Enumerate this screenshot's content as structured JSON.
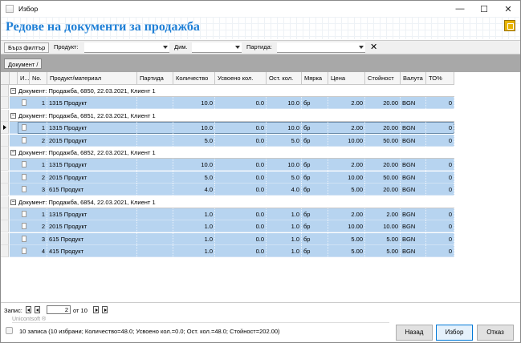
{
  "window": {
    "title": "Избор"
  },
  "header": {
    "title": "Редове на документи за продажба"
  },
  "filter": {
    "quick_filter_label": "Бърз филтър",
    "product_label": "Продукт:",
    "dim_label": "Дим.",
    "batch_label": "Партида:"
  },
  "grouping": {
    "chip_label": "Документ",
    "chip_sort": "/"
  },
  "columns": [
    "И...",
    "No.",
    "Продукт/материал",
    "Партида",
    "Количество",
    "Усвоено кол.",
    "Ост. кол.",
    "Мярка",
    "Цена",
    "Стойност",
    "Валута",
    "ТО%"
  ],
  "groups": [
    {
      "label": "Документ: Продажба, 6850, 22.03.2021, Клиент 1",
      "rows": [
        {
          "no": "1",
          "product": "1315 Продукт",
          "batch": "",
          "qty": "10.0",
          "used": "0.0",
          "rest": "10.0",
          "unit": "бр",
          "price": "2.00",
          "value": "20.00",
          "currency": "BGN",
          "to": "0"
        }
      ]
    },
    {
      "label": "Документ: Продажба, 6851, 22.03.2021, Клиент 1",
      "rows": [
        {
          "no": "1",
          "product": "1315 Продукт",
          "batch": "",
          "qty": "10.0",
          "used": "0.0",
          "rest": "10.0",
          "unit": "бр",
          "price": "2.00",
          "value": "20.00",
          "currency": "BGN",
          "to": "0"
        },
        {
          "no": "2",
          "product": "2015 Продукт",
          "batch": "",
          "qty": "5.0",
          "used": "0.0",
          "rest": "5.0",
          "unit": "бр",
          "price": "10.00",
          "value": "50.00",
          "currency": "BGN",
          "to": "0"
        }
      ]
    },
    {
      "label": "Документ: Продажба, 6852, 22.03.2021, Клиент 1",
      "rows": [
        {
          "no": "1",
          "product": "1315 Продукт",
          "batch": "",
          "qty": "10.0",
          "used": "0.0",
          "rest": "10.0",
          "unit": "бр",
          "price": "2.00",
          "value": "20.00",
          "currency": "BGN",
          "to": "0"
        },
        {
          "no": "2",
          "product": "2015 Продукт",
          "batch": "",
          "qty": "5.0",
          "used": "0.0",
          "rest": "5.0",
          "unit": "бр",
          "price": "10.00",
          "value": "50.00",
          "currency": "BGN",
          "to": "0"
        },
        {
          "no": "3",
          "product": "615 Продукт",
          "batch": "",
          "qty": "4.0",
          "used": "0.0",
          "rest": "4.0",
          "unit": "бр",
          "price": "5.00",
          "value": "20.00",
          "currency": "BGN",
          "to": "0"
        }
      ]
    },
    {
      "label": "Документ: Продажба, 6854, 22.03.2021, Клиент 1",
      "rows": [
        {
          "no": "1",
          "product": "1315 Продукт",
          "batch": "",
          "qty": "1.0",
          "used": "0.0",
          "rest": "1.0",
          "unit": "бр",
          "price": "2.00",
          "value": "2.00",
          "currency": "BGN",
          "to": "0"
        },
        {
          "no": "2",
          "product": "2015 Продукт",
          "batch": "",
          "qty": "1.0",
          "used": "0.0",
          "rest": "1.0",
          "unit": "бр",
          "price": "10.00",
          "value": "10.00",
          "currency": "BGN",
          "to": "0"
        },
        {
          "no": "3",
          "product": "615 Продукт",
          "batch": "",
          "qty": "1.0",
          "used": "0.0",
          "rest": "1.0",
          "unit": "бр",
          "price": "5.00",
          "value": "5.00",
          "currency": "BGN",
          "to": "0"
        },
        {
          "no": "4",
          "product": "415 Продукт",
          "batch": "",
          "qty": "1.0",
          "used": "0.0",
          "rest": "1.0",
          "unit": "бр",
          "price": "5.00",
          "value": "5.00",
          "currency": "BGN",
          "to": "0"
        }
      ]
    }
  ],
  "navigator": {
    "label": "Запис:",
    "current": "2",
    "of_text": "от 10"
  },
  "brand": "Unicontsoft ®",
  "status": "10 записа (10 избрани; Количество=48.0; Усвоено кол.=0.0; Ост. кол.=48.0; Стойност=202.00)",
  "buttons": {
    "back": "Назад",
    "select": "Избор",
    "cancel": "Отказ"
  },
  "icons": [
    "app-icon",
    "minimize-icon",
    "maximize-icon",
    "close-icon",
    "note-icon",
    "clear-filter-icon",
    "document-icon",
    "row-pointer-icon",
    "status-icon"
  ]
}
